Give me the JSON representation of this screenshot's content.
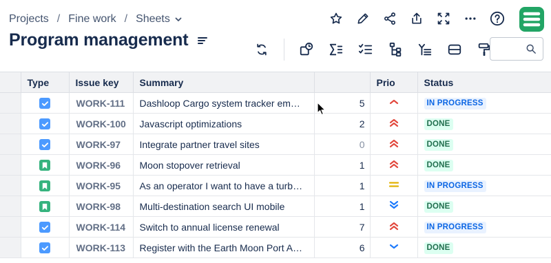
{
  "breadcrumb": {
    "items": [
      "Projects",
      "Fine work",
      "Sheets"
    ]
  },
  "page": {
    "title": "Program management"
  },
  "search": {
    "placeholder": "",
    "value": ""
  },
  "icons": {
    "top_actions": [
      "star-icon",
      "pencil-icon",
      "share-icon",
      "export-icon",
      "fullscreen-icon",
      "more-icon",
      "help-icon"
    ],
    "toolbar": [
      "refresh-icon",
      "view-icon",
      "sum-icon",
      "checklist-icon",
      "hierarchy-icon",
      "filter-list-icon",
      "card-icon",
      "format-paint-icon"
    ]
  },
  "colors": {
    "logo": "#22a565",
    "task": "#4c9aff",
    "story": "#36b37e",
    "prio_high": "#e2483d",
    "prio_medium": "#e2b203",
    "prio_low": "#1d7afc"
  },
  "table": {
    "columns": [
      "Type",
      "Issue key",
      "Summary",
      "",
      "Prio",
      "Status"
    ],
    "rows": [
      {
        "type": "task",
        "key": "WORK-111",
        "summary": "Dashloop Cargo system tracker em…",
        "estimate": "5",
        "prio": "medium-high",
        "status": "IN PROGRESS",
        "status_kind": "progress"
      },
      {
        "type": "task",
        "key": "WORK-100",
        "summary": "Javascript optimizations",
        "estimate": "2",
        "prio": "high",
        "status": "DONE",
        "status_kind": "done"
      },
      {
        "type": "task",
        "key": "WORK-97",
        "summary": "Integrate partner travel sites",
        "estimate": "0",
        "prio": "high",
        "status": "DONE",
        "status_kind": "done"
      },
      {
        "type": "story",
        "key": "WORK-96",
        "summary": "Moon stopover retrieval",
        "estimate": "1",
        "prio": "high",
        "status": "DONE",
        "status_kind": "done"
      },
      {
        "type": "story",
        "key": "WORK-95",
        "summary": "As an operator I want to have a turb…",
        "estimate": "1",
        "prio": "medium",
        "status": "IN PROGRESS",
        "status_kind": "progress"
      },
      {
        "type": "story",
        "key": "WORK-98",
        "summary": "Multi-destination search UI mobile",
        "estimate": "1",
        "prio": "lowest",
        "status": "DONE",
        "status_kind": "done"
      },
      {
        "type": "task",
        "key": "WORK-114",
        "summary": "Switch to annual license renewal",
        "estimate": "7",
        "prio": "high",
        "status": "IN PROGRESS",
        "status_kind": "progress"
      },
      {
        "type": "task",
        "key": "WORK-113",
        "summary": "Register with the Earth Moon Port A…",
        "estimate": "6",
        "prio": "low",
        "status": "DONE",
        "status_kind": "done"
      }
    ]
  }
}
